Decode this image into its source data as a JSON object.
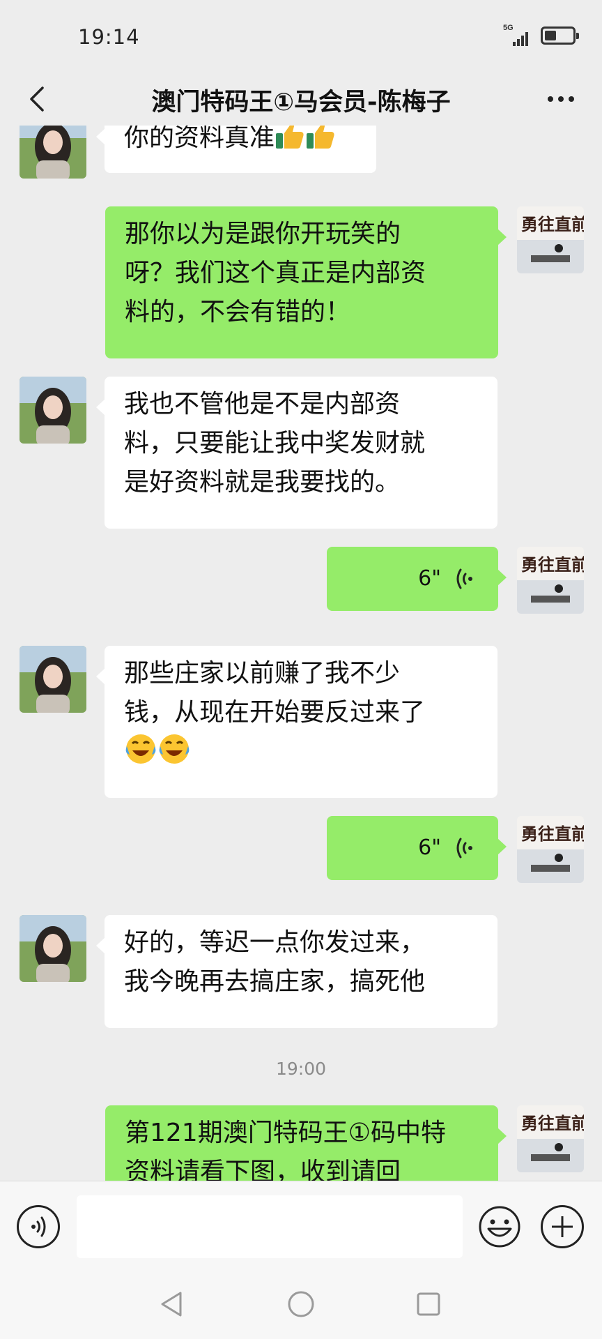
{
  "status_bar": {
    "time": "19:14",
    "network": "5G"
  },
  "header": {
    "title": "澳门特码王①马会员-陈梅子"
  },
  "messages": [
    {
      "side": "left",
      "text": "你的资料真准"
    },
    {
      "side": "right",
      "lines": [
        "那你以为是跟你开玩笑的",
        "呀？我们这个真正是内部资",
        "料的，不会有错的！"
      ]
    },
    {
      "side": "left",
      "lines": [
        "我也不管他是不是内部资",
        "料，只要能让我中奖发财就",
        "是好资料就是我要找的。"
      ]
    },
    {
      "side": "right",
      "type": "voice",
      "duration": "6\""
    },
    {
      "side": "left",
      "lines": [
        "那些庄家以前赚了我不少",
        "钱，从现在开始要反过来了"
      ]
    },
    {
      "side": "right",
      "type": "voice",
      "duration": "6\""
    },
    {
      "side": "left",
      "lines": [
        "好的，等迟一点你发过来，",
        "我今晚再去搞庄家，搞死他"
      ]
    },
    {
      "type": "timestamp",
      "text": "19:00"
    },
    {
      "side": "right",
      "lines": [
        "第121期澳门特码王①码中特",
        "资料请看下图，收到请回"
      ]
    }
  ],
  "input_bar": {
    "placeholder": ""
  },
  "icons": {
    "back": "chevron-left-icon",
    "more": "more-dots-icon",
    "thumbs_up": "thumbs-up-icon",
    "laugh_cry": "laughing-crying-icon",
    "voice_wave": "voice-wave-icon",
    "emoji": "emoji-smile-icon",
    "plus": "plus-icon"
  },
  "colors": {
    "right_bubble": "#95ec69",
    "left_bubble": "#ffffff",
    "background": "#ededed"
  }
}
